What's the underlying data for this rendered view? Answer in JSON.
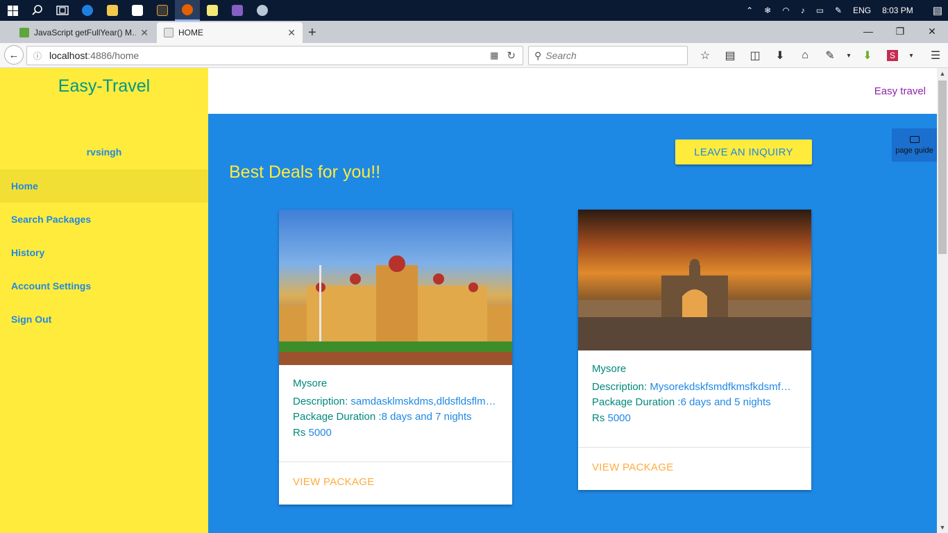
{
  "taskbar": {
    "icons": [
      "windows-icon",
      "search-icon",
      "task-view-icon",
      "edge-icon",
      "file-explorer-icon",
      "store-icon",
      "app-15-icon",
      "firefox-icon",
      "notepad-icon",
      "visual-studio-icon",
      "app-icon"
    ],
    "language": "ENG",
    "time": "8:03 PM"
  },
  "browser": {
    "tabs": [
      {
        "title": "JavaScript getFullYear() M…",
        "active": false,
        "color": "#5ea63b"
      },
      {
        "title": "HOME",
        "active": true,
        "color": "#e3e3e3"
      }
    ],
    "url_host": "localhost",
    "url_path": ":4886/home",
    "search_placeholder": "Search"
  },
  "sidebar": {
    "brand": "Easy-Travel",
    "username": "rvsingh",
    "items": [
      {
        "label": "Home",
        "active": true
      },
      {
        "label": "Search Packages",
        "active": false
      },
      {
        "label": "History",
        "active": false
      },
      {
        "label": "Account Settings",
        "active": false
      },
      {
        "label": "Sign Out",
        "active": false
      }
    ]
  },
  "header": {
    "title": "Easy travel"
  },
  "main": {
    "heading": "Best Deals for you!!",
    "inquiry_button": "LEAVE AN INQUIRY",
    "page_guide": "page guide",
    "cards": [
      {
        "place": "Mysore",
        "description_label": "Description: ",
        "description": "samdasklmskdms,dldsfldsflm…",
        "duration_label": "Package Duration :",
        "duration": "8 days and 7 nights",
        "price_label": "Rs ",
        "price": "5000",
        "action": "VIEW PACKAGE"
      },
      {
        "place": "Mysore",
        "description_label": "Description: ",
        "description": "Mysorekdskfsmdfkmsfkdsmf…",
        "duration_label": "Package Duration :",
        "duration": "6 days and 5 nights",
        "price_label": "Rs ",
        "price": "5000",
        "action": "VIEW PACKAGE"
      }
    ]
  },
  "colors": {
    "sidebar": "#ffeb3b",
    "main": "#1e88e5",
    "brand": "#009688",
    "action": "#ffab40"
  }
}
